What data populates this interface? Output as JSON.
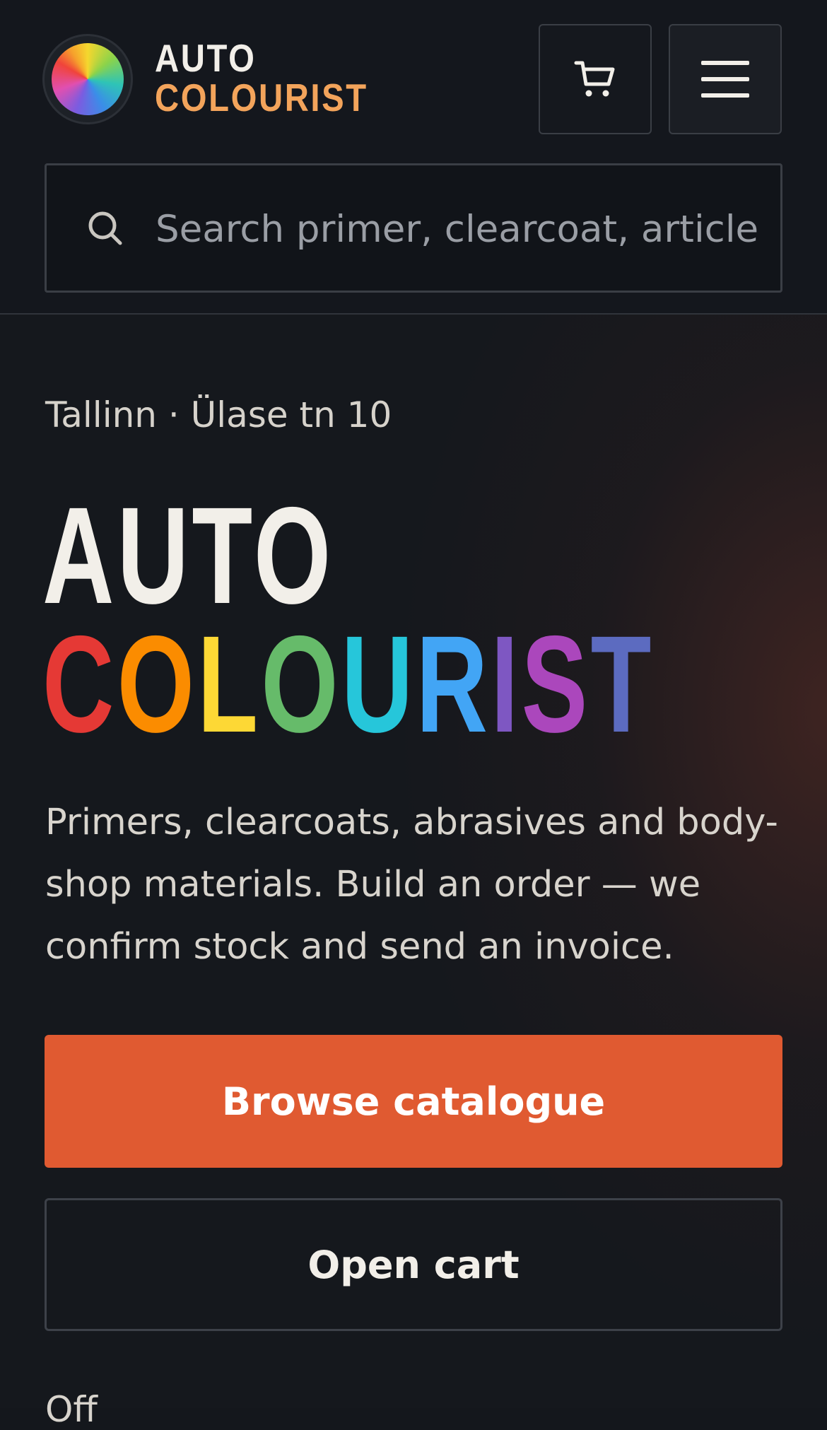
{
  "header": {
    "brand_line1": "AUTO",
    "brand_line2": "COLOURIST",
    "brand_line2_color": "#f3a45b",
    "cart_icon": "cart-icon",
    "menu_icon": "hamburger-menu-icon"
  },
  "search": {
    "placeholder": "Search primer, clearcoat, article"
  },
  "hero": {
    "location": "Tallinn · Ülase tn 10",
    "title_line1": "AUTO",
    "title_line2_letters": [
      {
        "ch": "C",
        "color": "#e53935"
      },
      {
        "ch": "O",
        "color": "#fb8c00"
      },
      {
        "ch": "L",
        "color": "#fdd835"
      },
      {
        "ch": "O",
        "color": "#66bb6a"
      },
      {
        "ch": "U",
        "color": "#26c6da"
      },
      {
        "ch": "R",
        "color": "#42a5f5"
      },
      {
        "ch": "I",
        "color": "#7e57c2"
      },
      {
        "ch": "S",
        "color": "#ab47bc"
      },
      {
        "ch": "T",
        "color": "#5c6bc0"
      }
    ],
    "description": "Primers, clearcoats, abrasives and body-shop materials. Build an order — we confirm stock and send an invoice.",
    "primary_button": "Browse catalogue",
    "secondary_button": "Open cart",
    "cutoff_text": "Off"
  },
  "colors": {
    "accent": "#e05a31",
    "background": "#14171c"
  }
}
